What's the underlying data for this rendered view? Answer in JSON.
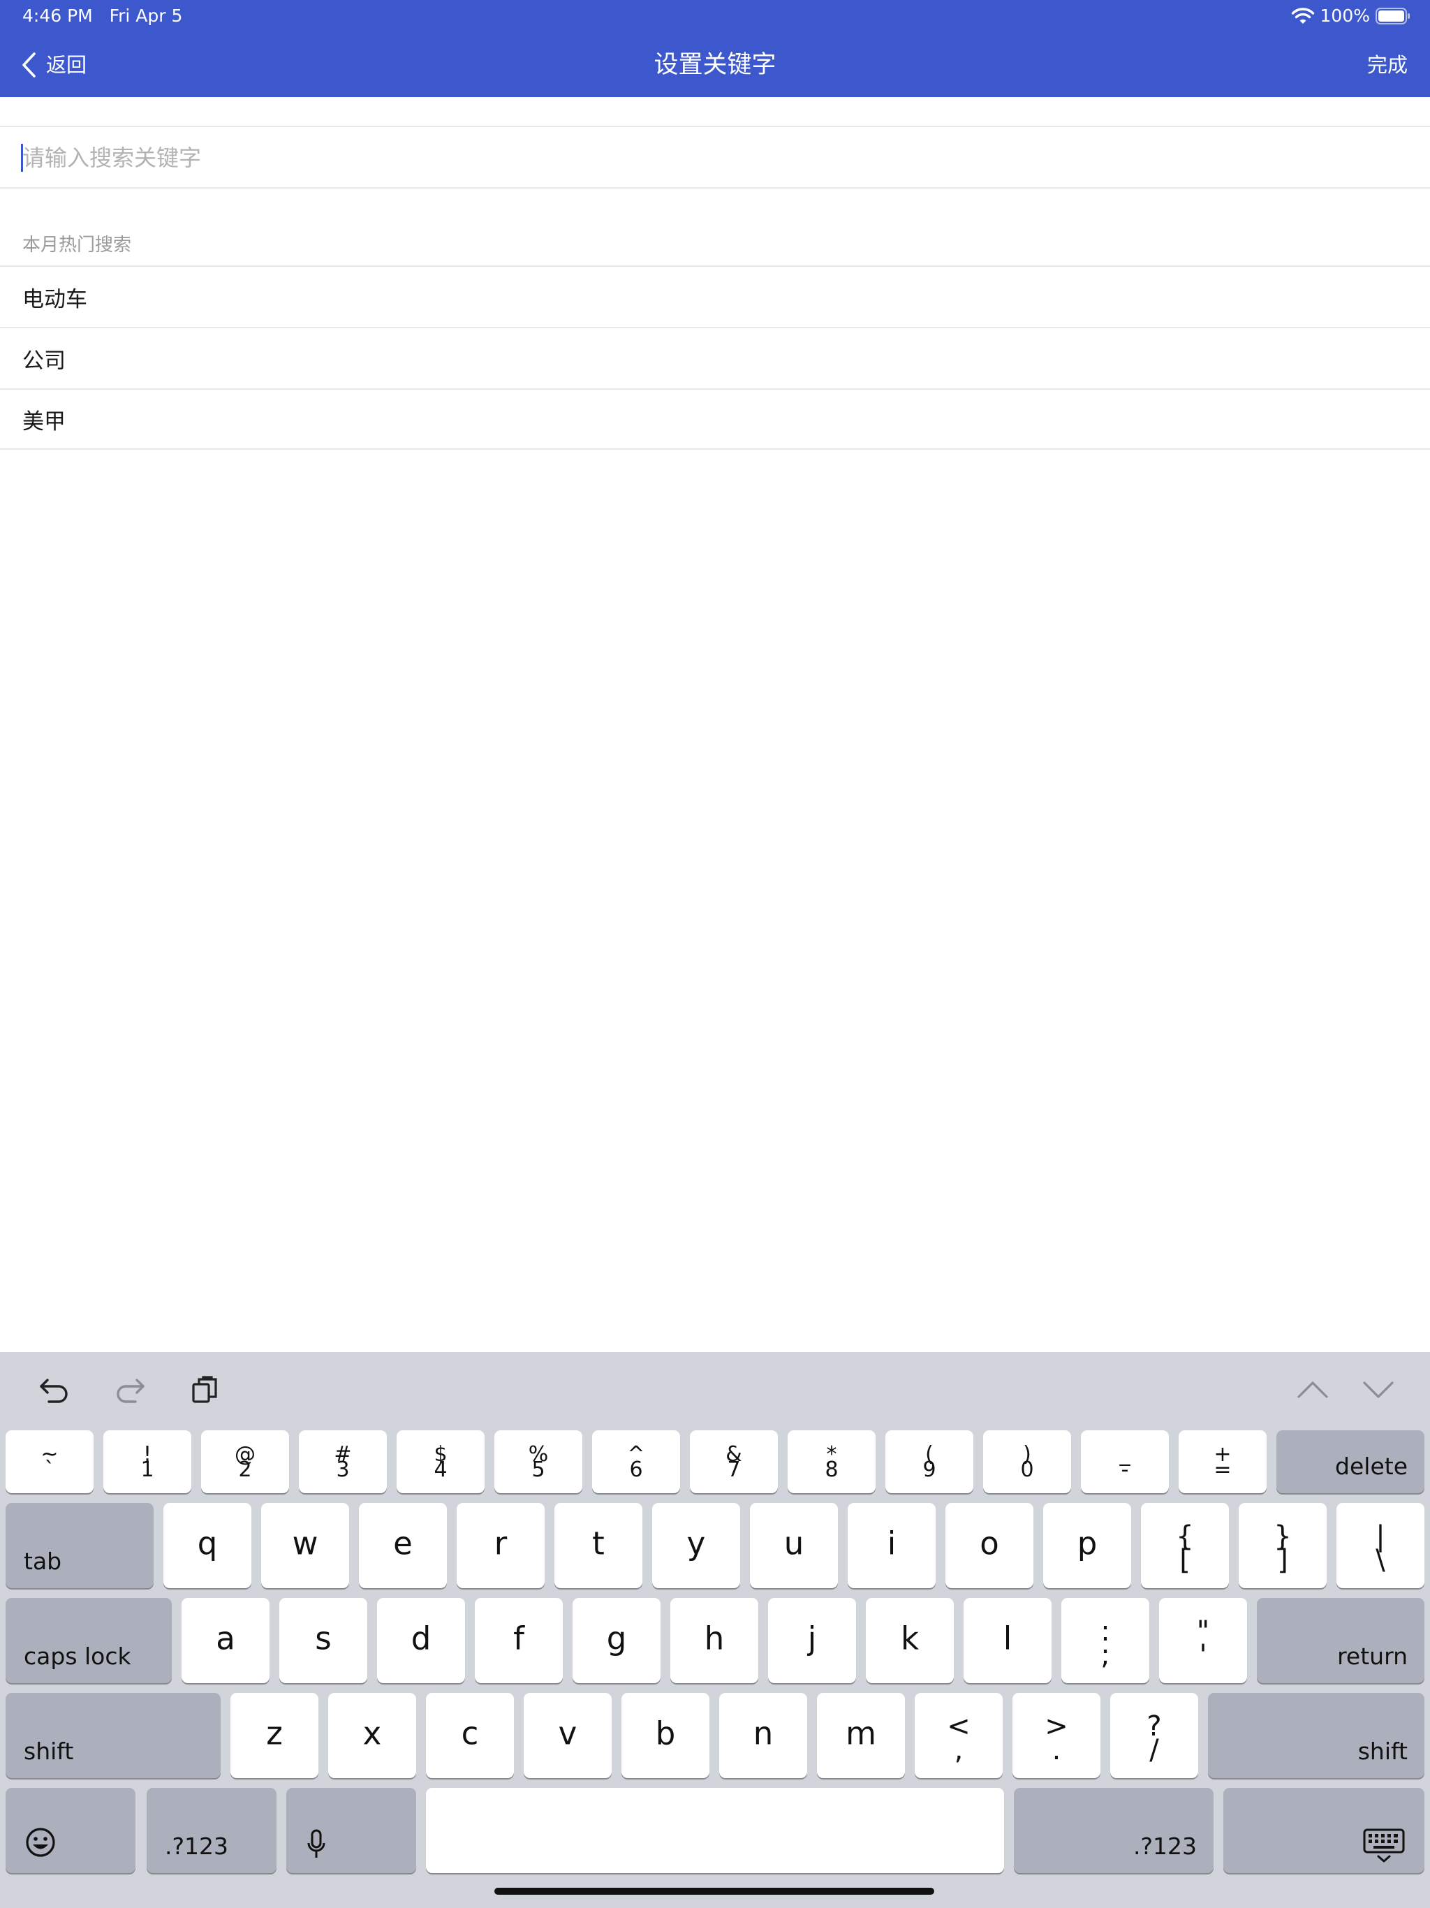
{
  "status_bar": {
    "time": "4:46 PM",
    "date": "Fri Apr 5",
    "battery": "100%"
  },
  "nav": {
    "back_label": "返回",
    "title": "设置关键字",
    "done_label": "完成"
  },
  "search": {
    "placeholder": "请输入搜索关键字",
    "value": ""
  },
  "hot": {
    "section_title": "本月热门搜索",
    "items": [
      "电动车",
      "公司",
      "美甲"
    ]
  },
  "colors": {
    "accent": "#3d58cc",
    "keyboard_bg": "#d1d4db",
    "func_key": "#abb0bc"
  },
  "keyboard": {
    "toolbar_icons": [
      "undo-icon",
      "redo-icon",
      "paste-icon",
      "chevron-up-icon",
      "chevron-down-icon"
    ],
    "row1": [
      {
        "top": "~",
        "bot": "`"
      },
      {
        "top": "!",
        "bot": "1"
      },
      {
        "top": "@",
        "bot": "2"
      },
      {
        "top": "#",
        "bot": "3"
      },
      {
        "top": "$",
        "bot": "4"
      },
      {
        "top": "%",
        "bot": "5"
      },
      {
        "top": "^",
        "bot": "6"
      },
      {
        "top": "&",
        "bot": "7"
      },
      {
        "top": "*",
        "bot": "8"
      },
      {
        "top": "(",
        "bot": "9"
      },
      {
        "top": ")",
        "bot": "0"
      },
      {
        "top": "_",
        "bot": "-"
      },
      {
        "top": "+",
        "bot": "="
      }
    ],
    "delete": "delete",
    "tab": "tab",
    "row2": [
      "q",
      "w",
      "e",
      "r",
      "t",
      "y",
      "u",
      "i",
      "o",
      "p"
    ],
    "row2_sym": [
      {
        "top": "{",
        "bot": "["
      },
      {
        "top": "}",
        "bot": "]"
      },
      {
        "top": "|",
        "bot": "\\"
      }
    ],
    "caps_lock": "caps lock",
    "row3": [
      "a",
      "s",
      "d",
      "f",
      "g",
      "h",
      "j",
      "k",
      "l"
    ],
    "row3_sym": [
      {
        "top": ":",
        "bot": ";"
      },
      {
        "top": "\"",
        "bot": "'"
      }
    ],
    "return": "return",
    "shift": "shift",
    "row4": [
      "z",
      "x",
      "c",
      "v",
      "b",
      "n",
      "m"
    ],
    "row4_sym": [
      {
        "top": "<",
        "bot": ","
      },
      {
        "top": ">",
        "bot": "."
      },
      {
        "top": "?",
        "bot": "/"
      }
    ],
    "numbers_label": ".?123",
    "bottom_icons": [
      "emoji-icon",
      "microphone-icon",
      "keyboard-dismiss-icon"
    ]
  }
}
